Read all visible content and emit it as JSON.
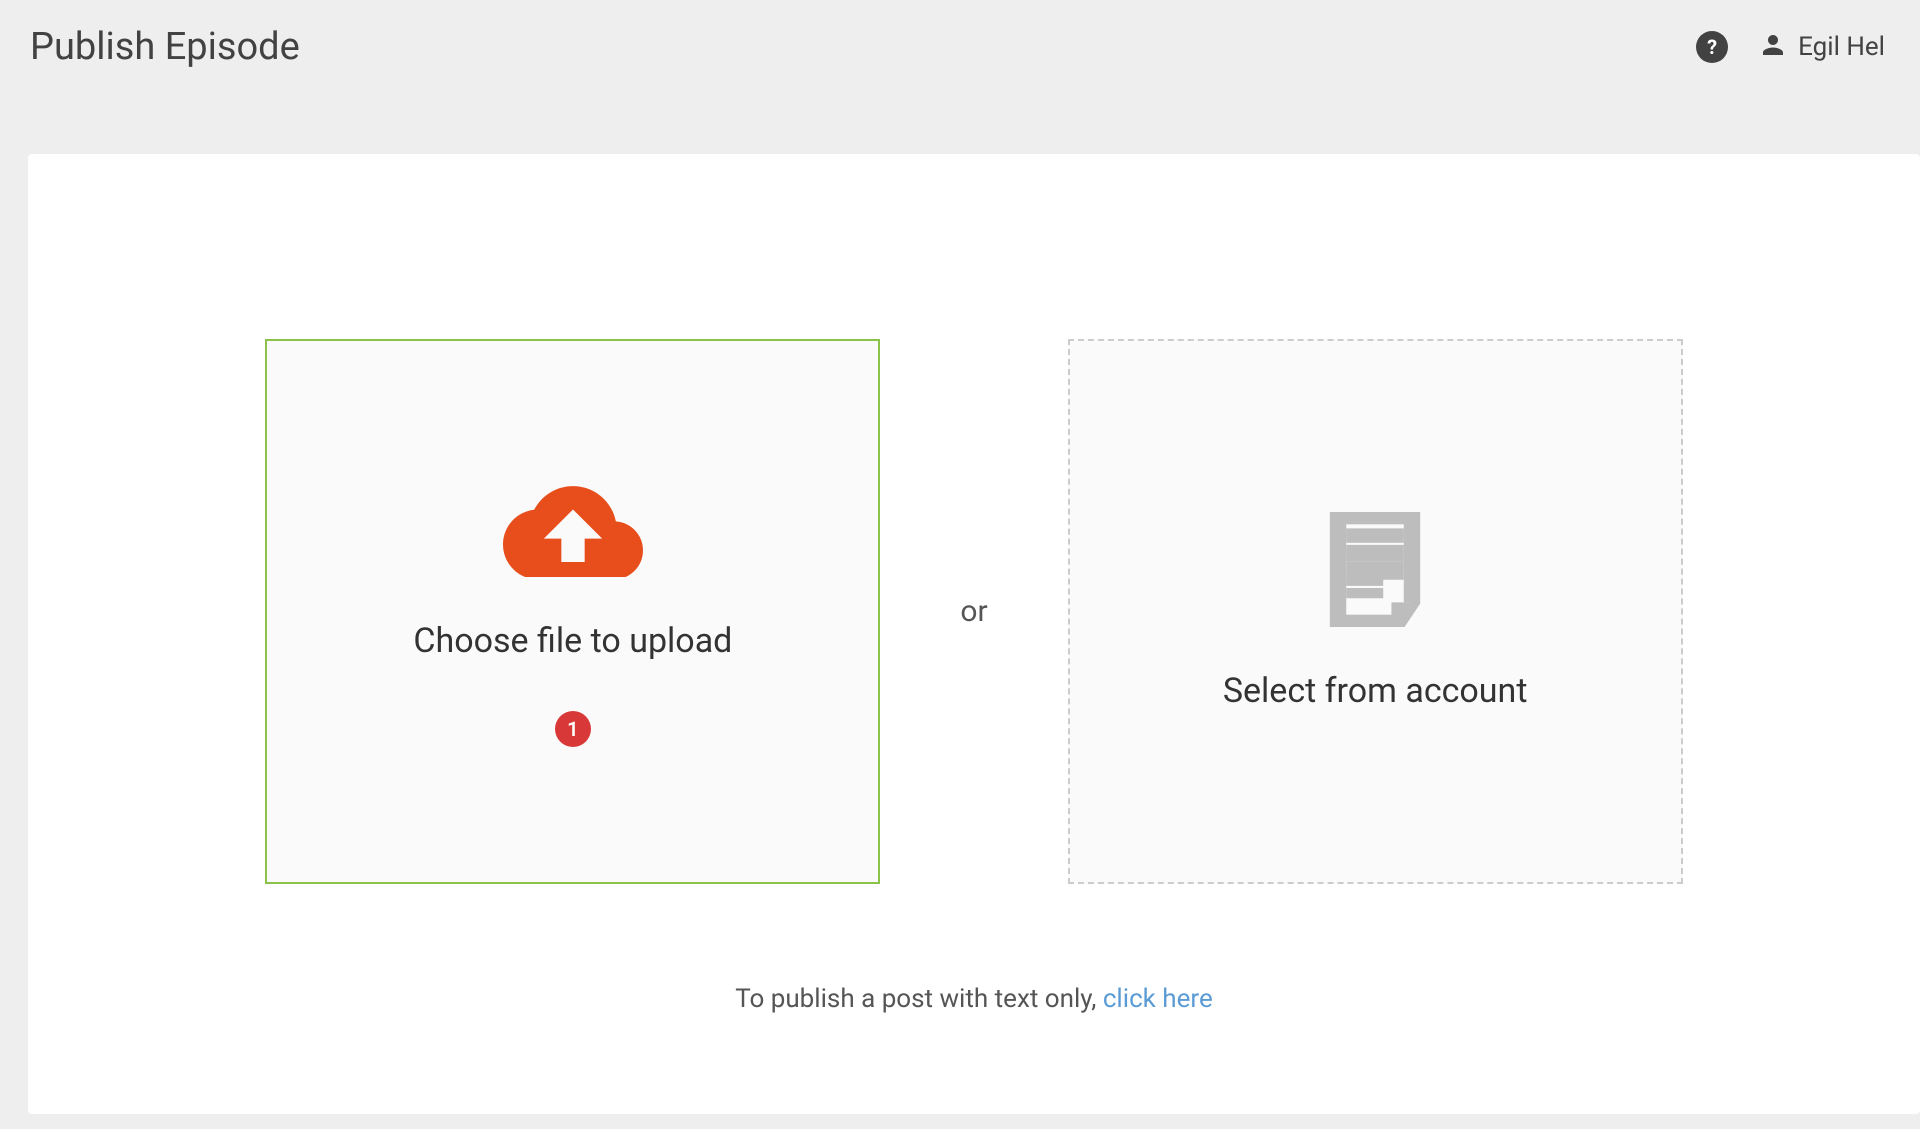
{
  "header": {
    "title": "Publish Episode",
    "user_name": "Egil Hel"
  },
  "main": {
    "upload_option_label": "Choose file to upload",
    "upload_badge": "1",
    "account_option_label": "Select from account",
    "divider_text": "or",
    "footer_prefix": "To publish a post with text only, ",
    "footer_link": "click here"
  }
}
